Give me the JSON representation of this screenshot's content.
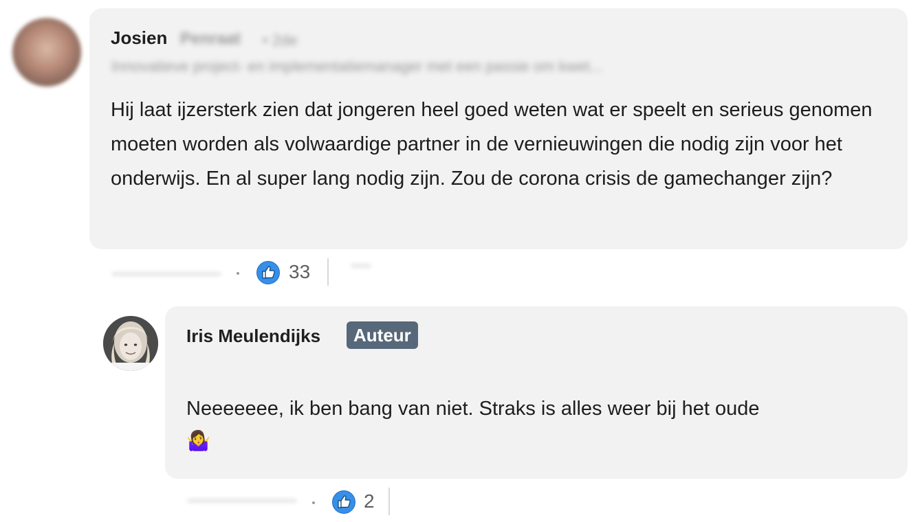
{
  "comment": {
    "author": "Josien",
    "author_last_name": "Penraat",
    "connection": "• 2de",
    "headline": "Innovatieve project- en implementatiemanager met een passie om kwet...",
    "text": "Hij laat ijzersterk zien dat jongeren heel goed weten wat er speelt en serieus genomen moeten worden als volwaardige partner in de vernieuwingen die nodig zijn voor het onderwijs. En al super lang nodig zijn. Zou de corona crisis de gamechanger zijn?",
    "reaction_count": "33"
  },
  "reply": {
    "author": "Iris Meulendijks",
    "badge": "Auteur",
    "text": "Neeeeeee, ik ben bang van niet. Straks is alles weer bij het oude",
    "emoji": "🤷‍♀️",
    "reaction_count": "2"
  },
  "colors": {
    "bubble": "#f2f2f2",
    "badge": "#56687a",
    "like": "#378fe9"
  },
  "icons": {
    "reaction": "like-thumb-icon"
  }
}
